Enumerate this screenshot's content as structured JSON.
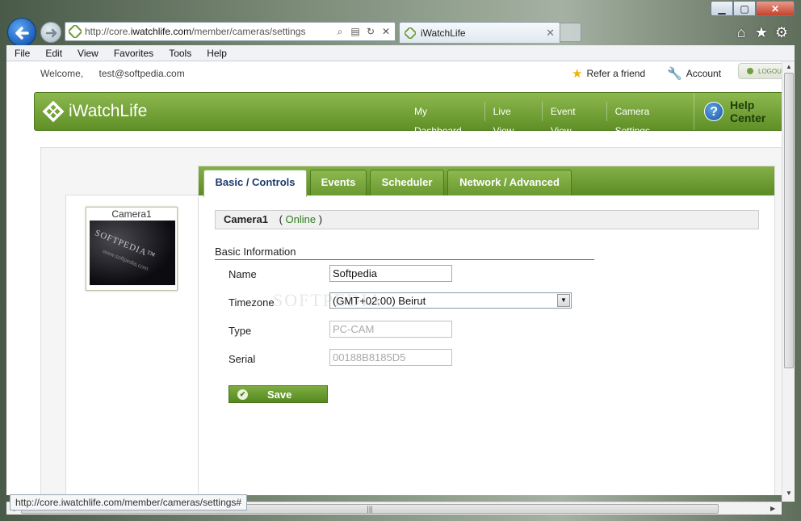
{
  "browser": {
    "url_prefix": "http://core.",
    "url_domain": "iwatchlife.com",
    "url_path": "/member/cameras/settings",
    "tab_title": "iWatchLife",
    "menu": [
      "File",
      "Edit",
      "View",
      "Favorites",
      "Tools",
      "Help"
    ],
    "status_url": "http://core.iwatchlife.com/member/cameras/settings#"
  },
  "header": {
    "welcome_label": "Welcome,",
    "user_email": "test@softpedia.com",
    "refer_label": "Refer a friend",
    "account_label": "Account",
    "logout_label": "LOGOUT"
  },
  "site": {
    "logo_text": "iWatchLife",
    "nav": [
      "My Dashboard",
      "Live View",
      "Event View",
      "Camera Settings"
    ],
    "help_label": "Help Center"
  },
  "camera_list": {
    "thumb_label": "Camera1",
    "thumb_watermark": "SOFTPEDIA™",
    "thumb_watermark_small": "www.softpedia.com"
  },
  "tabs": [
    "Basic / Controls",
    "Events",
    "Scheduler",
    "Network / Advanced"
  ],
  "camera_bar": {
    "name": "Camera1",
    "paren_open": "(",
    "status": "Online",
    "paren_close": ")"
  },
  "form": {
    "section_title": "Basic Information",
    "name_label": "Name",
    "name_value": "Softpedia",
    "timezone_label": "Timezone",
    "timezone_value": "(GMT+02:00) Beirut",
    "type_label": "Type",
    "type_placeholder": "PC-CAM",
    "serial_label": "Serial",
    "serial_placeholder": "00188B8185D5",
    "save_label": "Save"
  },
  "watermark": "SOFTPEDIA",
  "colors": {
    "brand_green": "#6b9a30",
    "online_green": "#2e7d1c",
    "tab_active_text": "#1d3a70"
  }
}
